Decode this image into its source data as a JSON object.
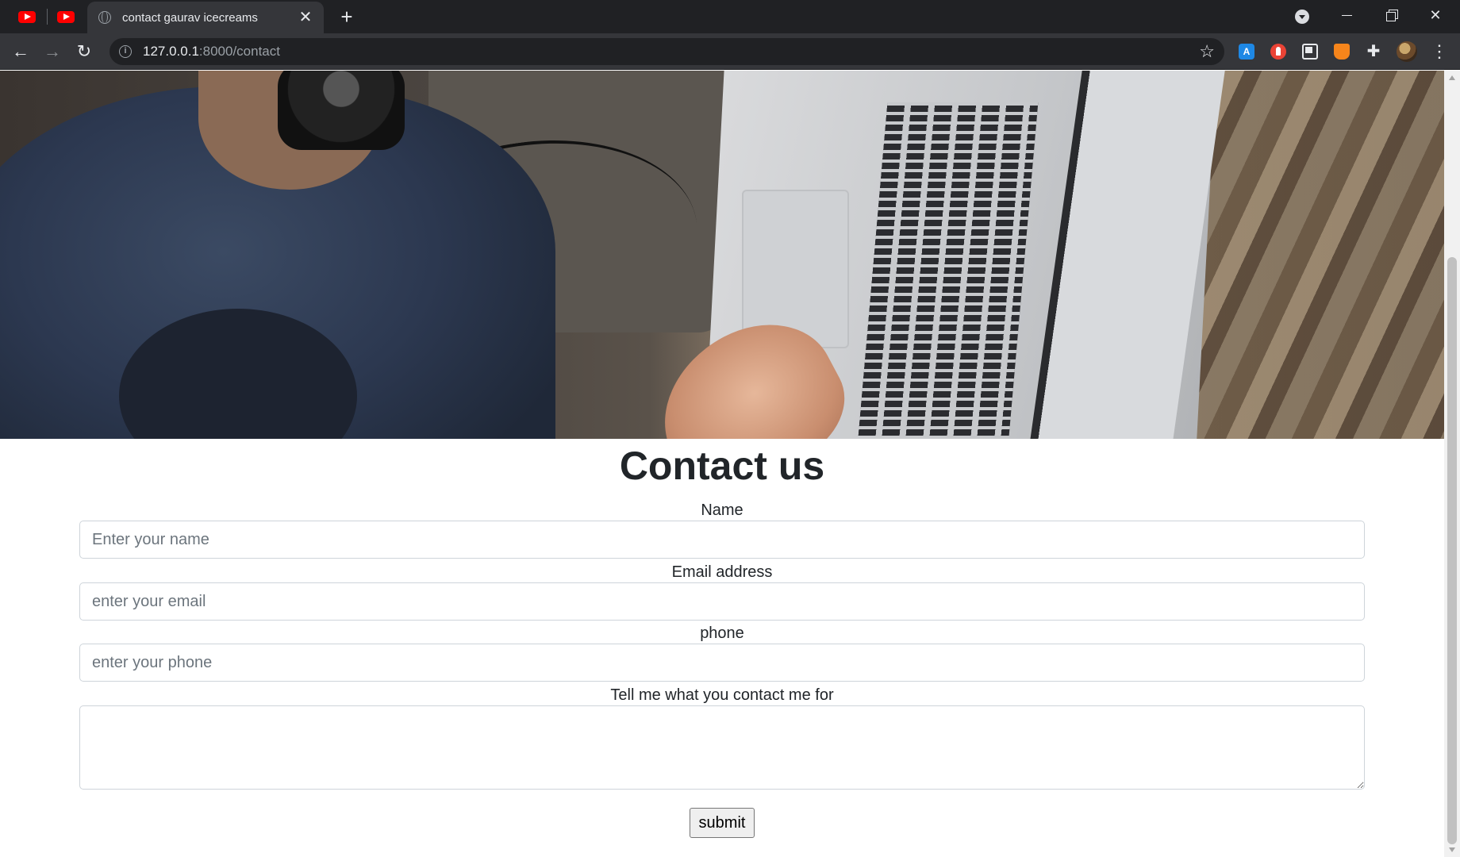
{
  "browser": {
    "pinned_tabs": [
      {
        "icon": "youtube-icon"
      },
      {
        "icon": "youtube-icon"
      }
    ],
    "active_tab": {
      "title": "contact gaurav icecreams",
      "close": "✕"
    },
    "new_tab": "+",
    "address": {
      "host": "127.0.0.1",
      "rest": ":8000/contact"
    },
    "window_controls": {
      "minimize": "",
      "restore": "",
      "close": "✕"
    }
  },
  "page": {
    "heading": "Contact us",
    "form": {
      "name_label": "Name",
      "name_placeholder": "Enter your name",
      "email_label": "Email address",
      "email_placeholder": "enter your email",
      "phone_label": "phone",
      "phone_placeholder": "enter your phone",
      "message_label": "Tell me what you contact me for",
      "message_value": "",
      "submit_label": "submit"
    }
  },
  "colors": {
    "chrome_dark": "#202124",
    "chrome_toolbar": "#35363a",
    "text": "#212529",
    "input_border": "#ced4da",
    "placeholder": "#6c757d"
  }
}
